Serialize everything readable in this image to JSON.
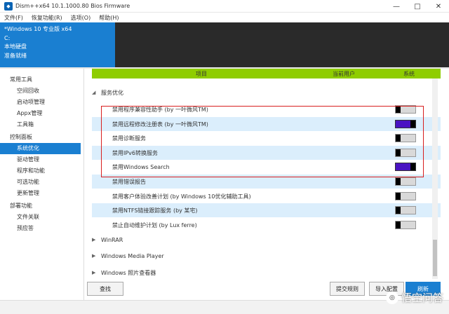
{
  "window": {
    "title": "Dism++x64 10.1.1000.80 Bios Firmware",
    "controls": [
      "—",
      "□",
      "✕"
    ]
  },
  "menu": [
    "文件(F)",
    "恢复功能(R)",
    "选项(O)",
    "帮助(H)"
  ],
  "info": {
    "os": "*Windows 10 专业版 x64",
    "drive": "C:",
    "disk": "本地硬盘",
    "status": "准备就绪"
  },
  "sidebar": {
    "groups": [
      {
        "label": "常用工具",
        "items": [
          {
            "label": "空间回收",
            "selected": false
          },
          {
            "label": "启动项管理",
            "selected": false
          },
          {
            "label": "Appx管理",
            "selected": false
          },
          {
            "label": "工具箱",
            "selected": false
          }
        ]
      },
      {
        "label": "控制面板",
        "items": [
          {
            "label": "系统优化",
            "selected": true
          },
          {
            "label": "驱动管理",
            "selected": false
          },
          {
            "label": "程序和功能",
            "selected": false
          },
          {
            "label": "可选功能",
            "selected": false
          },
          {
            "label": "更新管理",
            "selected": false
          }
        ]
      },
      {
        "label": "部署功能",
        "items": [
          {
            "label": "文件关联",
            "selected": false
          },
          {
            "label": "预应答",
            "selected": false
          }
        ]
      }
    ]
  },
  "table": {
    "headers": {
      "item": "项目",
      "user": "当前用户",
      "system": "系统"
    },
    "section_open": "服务优化",
    "rows": [
      {
        "label": "禁用程序兼容性助手 (by 一叶微风TM)",
        "shade": false,
        "on": false
      },
      {
        "label": "禁用远程修改注册表 (by 一叶微风TM)",
        "shade": true,
        "on": true
      },
      {
        "label": "禁用诊断服务",
        "shade": false,
        "on": false
      },
      {
        "label": "禁用IPv6转换服务",
        "shade": true,
        "on": false
      },
      {
        "label": "禁用Windows Search",
        "shade": false,
        "on": true
      },
      {
        "label": "禁用错误报告",
        "shade": true,
        "on": false
      },
      {
        "label": "禁用客户体验改善计划 (by Windows 10优化辅助工具)",
        "shade": false,
        "on": false
      },
      {
        "label": "禁用NTFS链接跟踪服务 (by 某宅)",
        "shade": true,
        "on": false
      },
      {
        "label": "禁止自动维护计划 (by Lux ferre)",
        "shade": false,
        "on": false
      }
    ],
    "collapsed_sections": [
      "WinRAR",
      "Windows Media Player",
      "Windows 照片查看器"
    ]
  },
  "buttons": {
    "search": "查找",
    "submit_rule": "提交规则",
    "import": "导入配置",
    "refresh": "刷新"
  },
  "watermark": "悟空问答",
  "colors": {
    "accent": "#1a7fd1",
    "header_green": "#8fcd00",
    "toggle_on": "#4a13c2",
    "highlight": "#d81e1e"
  }
}
